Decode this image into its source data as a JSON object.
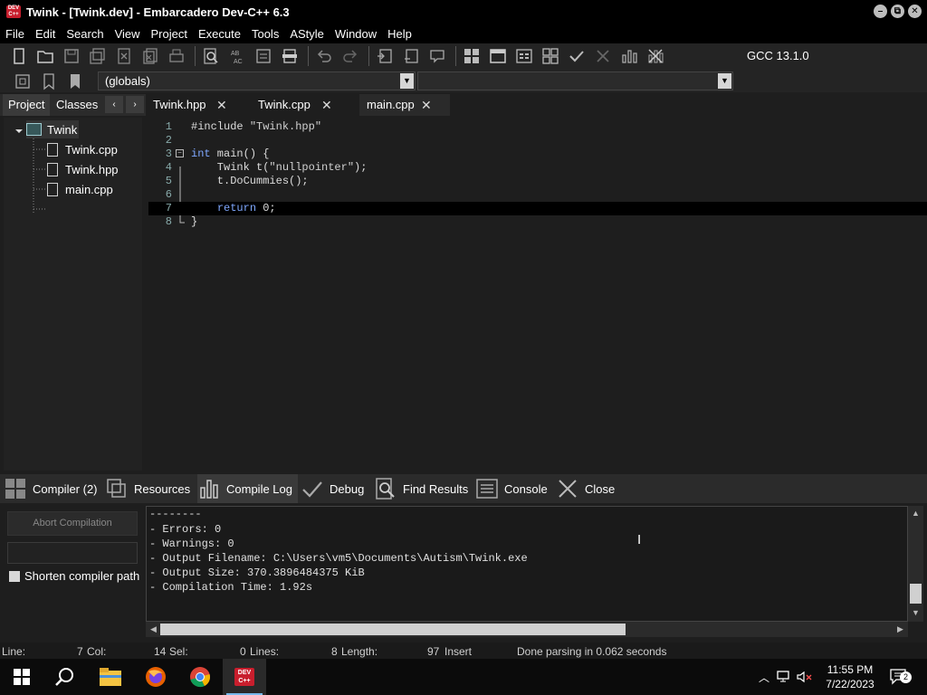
{
  "window": {
    "title": "Twink - [Twink.dev] - Embarcadero Dev-C++ 6.3",
    "logo_text": "DEV C++",
    "controls": [
      "–",
      "⧉",
      "✕"
    ]
  },
  "menu": [
    "File",
    "Edit",
    "Search",
    "View",
    "Project",
    "Execute",
    "Tools",
    "AStyle",
    "Window",
    "Help"
  ],
  "toolbar": {
    "compiler": "GCC 13.1.0",
    "scope_combo": "(globals)",
    "function_combo": ""
  },
  "left_panel": {
    "tabs": [
      "Project",
      "Classes"
    ],
    "nav_prev": "‹",
    "nav_next": "›",
    "tree": {
      "project": "Twink",
      "files": [
        "Twink.cpp",
        "Twink.hpp",
        "main.cpp"
      ]
    }
  },
  "editor": {
    "tabs": [
      {
        "label": "Twink.hpp",
        "close": "✕"
      },
      {
        "label": "Twink.cpp",
        "close": "✕"
      },
      {
        "label": "main.cpp",
        "close": "✕"
      }
    ],
    "active_tab": "main.cpp",
    "lines": [
      {
        "n": "1",
        "pre": "#include ",
        "kw": "",
        "str": "\"Twink.hpp\"",
        "post": ""
      },
      {
        "n": "2",
        "pre": "",
        "kw": "",
        "str": "",
        "post": ""
      },
      {
        "n": "3",
        "pre": "",
        "kw": "int",
        "str": "",
        "post": " main() {"
      },
      {
        "n": "4",
        "pre": "    Twink t(",
        "kw": "",
        "str": "\"nullpointer\"",
        "post": ");"
      },
      {
        "n": "5",
        "pre": "    t.DoCummies();",
        "kw": "",
        "str": "",
        "post": ""
      },
      {
        "n": "6",
        "pre": "",
        "kw": "",
        "str": "",
        "post": ""
      },
      {
        "n": "7",
        "pre": "    ",
        "kw": "return",
        "str": "",
        "post": " 0;"
      },
      {
        "n": "8",
        "pre": "}",
        "kw": "",
        "str": "",
        "post": ""
      }
    ]
  },
  "bottom_tabs": [
    "Compiler (2)",
    "Resources",
    "Compile Log",
    "Debug",
    "Find Results",
    "Console",
    "Close"
  ],
  "bottom_active_tab": "Compile Log",
  "compile_controls": {
    "abort_label": "Abort Compilation",
    "shorten_label": "Shorten compiler path"
  },
  "compile_log": [
    "--------",
    "- Errors: 0",
    "- Warnings: 0",
    "- Output Filename: C:\\Users\\vm5\\Documents\\Autism\\Twink.exe",
    "- Output Size: 370.3896484375 KiB",
    "- Compilation Time: 1.92s"
  ],
  "statusbar": {
    "line_label": "Line:",
    "line_value": "7",
    "col_label": "Col:",
    "col_value": "14",
    "sel_label": "Sel:",
    "sel_value": "0",
    "lines_label": "Lines:",
    "lines_value": "8",
    "length_label": "Length:",
    "length_value": "97",
    "mode": "Insert",
    "message": "Done parsing in 0.062 seconds"
  },
  "taskbar": {
    "time": "11:55 PM",
    "date": "7/22/2023",
    "notifications": "2",
    "dev_label": "DEV C++"
  }
}
